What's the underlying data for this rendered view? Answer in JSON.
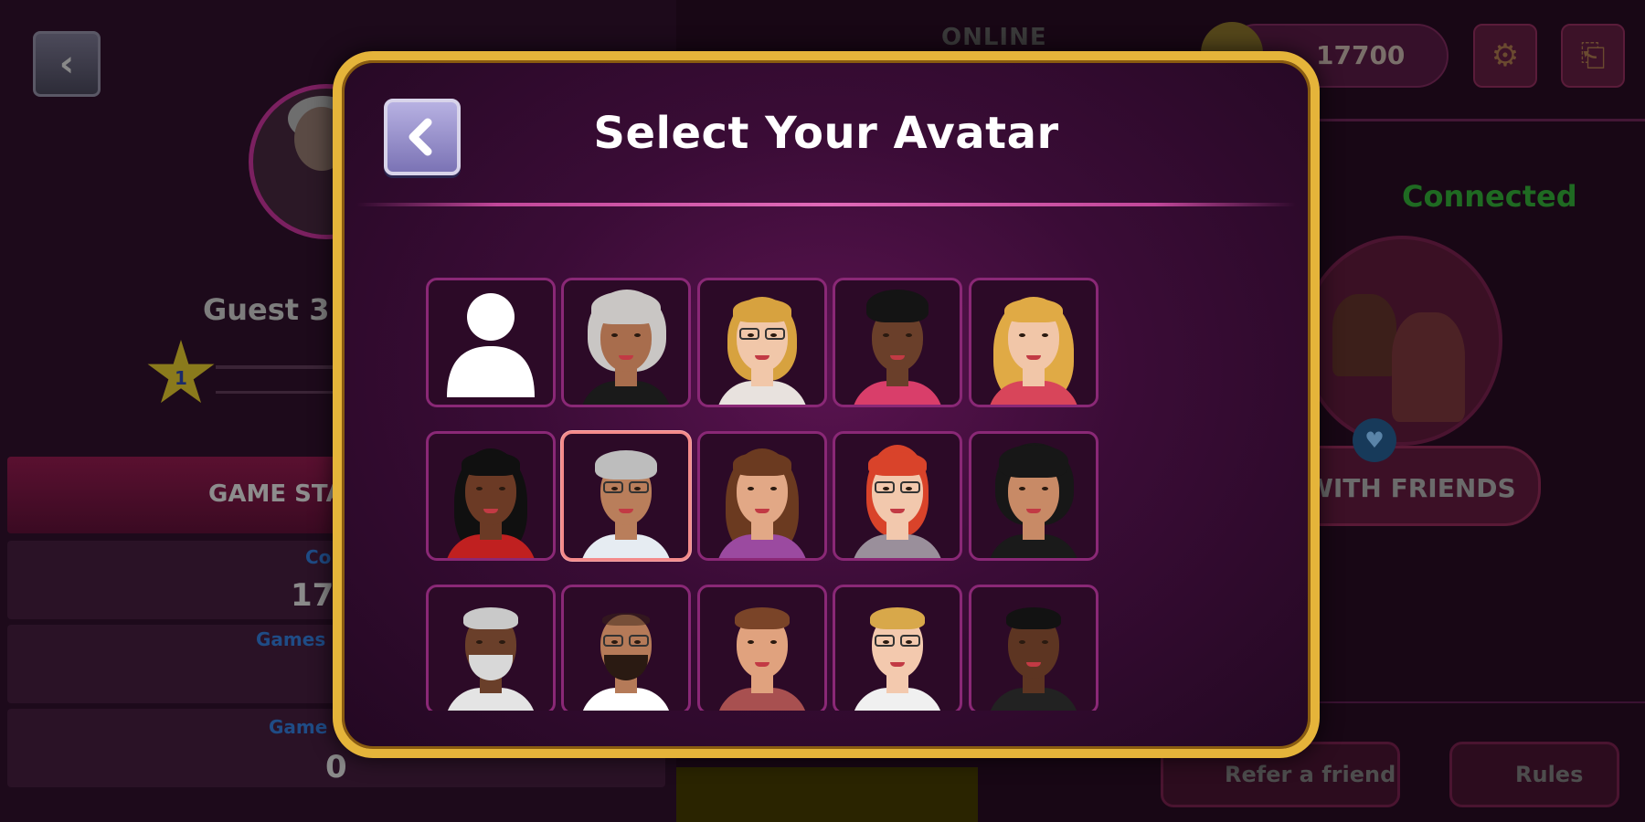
{
  "background": {
    "guest_name": "Guest 3",
    "level": "1",
    "stats_title": "GAME STA",
    "stats": [
      {
        "label": "Co",
        "value": "177"
      },
      {
        "label": "Games",
        "value": ""
      },
      {
        "label": "Game",
        "value": "0"
      }
    ],
    "online_label": "ONLINE",
    "coins": "17700",
    "status": "Connected",
    "play_friends_label": "WITH FRIENDS",
    "refer_label": "Refer a friend",
    "rules_label": "Rules"
  },
  "modal": {
    "title": "Select Your Avatar",
    "selected_index": 6,
    "avatars": [
      {
        "id": "default",
        "icon": "person-silhouette-icon"
      },
      {
        "id": "woman-gray-curly"
      },
      {
        "id": "woman-blonde-glasses"
      },
      {
        "id": "woman-black-bun"
      },
      {
        "id": "woman-blonde-wavy"
      },
      {
        "id": "woman-black-bangs"
      },
      {
        "id": "woman-gray-glasses"
      },
      {
        "id": "woman-brown-long"
      },
      {
        "id": "woman-red-glasses"
      },
      {
        "id": "woman-black-curly"
      },
      {
        "id": "man-gray-beard"
      },
      {
        "id": "man-bald-glasses"
      },
      {
        "id": "man-brown-stubble"
      },
      {
        "id": "man-blond-glasses"
      },
      {
        "id": "man-black-short"
      }
    ]
  },
  "colors": {
    "modal_border": "#e5b43a",
    "tile_border": "#8a2876",
    "selected_border": "#f48a8a",
    "connected": "#1f6a22"
  }
}
